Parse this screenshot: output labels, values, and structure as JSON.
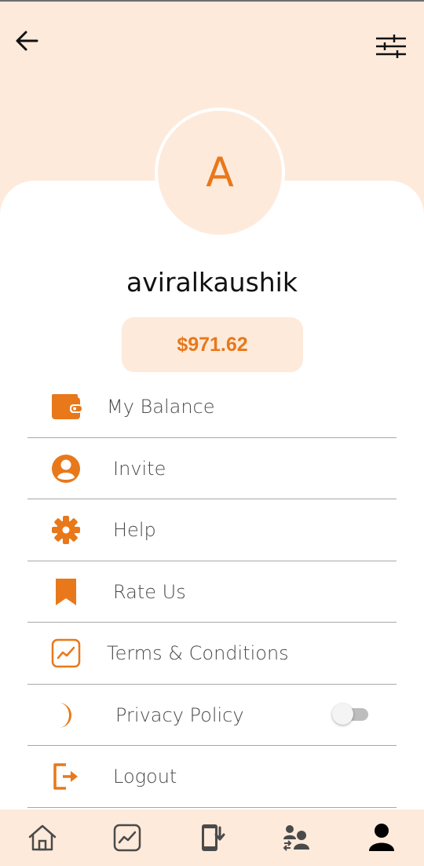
{
  "header": {
    "back_icon": "arrow-left-icon",
    "filter_icon": "sliders-icon"
  },
  "profile": {
    "avatar_letter": "A",
    "username": "aviralkaushik",
    "balance": "$971.62"
  },
  "menu": {
    "items": [
      {
        "label": "My Balance",
        "icon": "wallet-icon"
      },
      {
        "label": "Invite",
        "icon": "user-circle-icon"
      },
      {
        "label": "Help",
        "icon": "gear-icon"
      },
      {
        "label": "Rate Us",
        "icon": "bookmark-icon"
      },
      {
        "label": "Terms & Conditions",
        "icon": "chart-line-icon"
      },
      {
        "label": "Privacy Policy",
        "icon": "moon-icon",
        "toggle": false
      },
      {
        "label": "Logout",
        "icon": "logout-icon"
      }
    ]
  },
  "bottom_nav": {
    "items": [
      {
        "icon": "home-icon",
        "active": false
      },
      {
        "icon": "chart-line-icon",
        "active": false
      },
      {
        "icon": "phone-download-icon",
        "active": false
      },
      {
        "icon": "users-transfer-icon",
        "active": false
      },
      {
        "icon": "profile-icon",
        "active": true
      }
    ]
  },
  "colors": {
    "accent": "#e8781a",
    "header_bg": "#feeadb",
    "text": "#4a4a4a"
  }
}
